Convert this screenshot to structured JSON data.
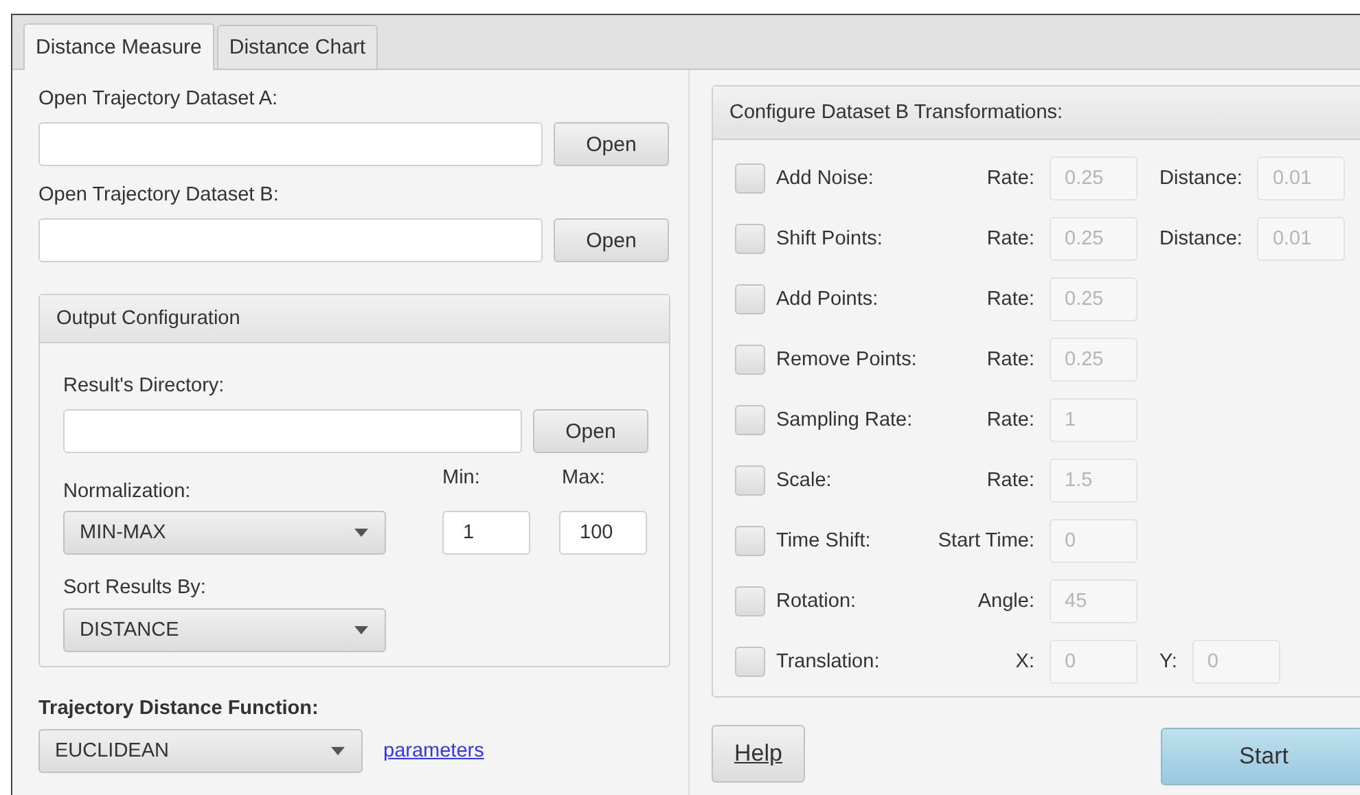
{
  "tabs": [
    {
      "label": "Distance Measure",
      "selected": true
    },
    {
      "label": "Distance Chart",
      "selected": false
    }
  ],
  "dataset_a": {
    "label": "Open Trajectory Dataset A:",
    "button": "Open"
  },
  "dataset_b": {
    "label": "Open Trajectory Dataset B:",
    "button": "Open"
  },
  "output_configuration": {
    "title": "Output Configuration",
    "results_directory": {
      "label": "Result's Directory:",
      "button": "Open"
    },
    "normalization": {
      "label": "Normalization:",
      "value": "MIN-MAX"
    },
    "min": {
      "label": "Min:",
      "value": "1"
    },
    "max": {
      "label": "Max:",
      "value": "100"
    },
    "sort_results_by": {
      "label": "Sort Results By:",
      "value": "DISTANCE"
    }
  },
  "distance_function": {
    "label": "Trajectory Distance Function:",
    "value": "EUCLIDEAN",
    "link": "parameters"
  },
  "transformations": {
    "title": "Configure Dataset B Transformations:",
    "items": [
      {
        "label": "Add Noise:",
        "checked": false,
        "params": [
          {
            "label": "Rate:",
            "value": "0.25"
          },
          {
            "label": "Distance:",
            "value": "0.01"
          }
        ]
      },
      {
        "label": "Shift Points:",
        "checked": false,
        "params": [
          {
            "label": "Rate:",
            "value": "0.25"
          },
          {
            "label": "Distance:",
            "value": "0.01"
          }
        ]
      },
      {
        "label": "Add Points:",
        "checked": false,
        "params": [
          {
            "label": "Rate:",
            "value": "0.25"
          }
        ]
      },
      {
        "label": "Remove Points:",
        "checked": false,
        "params": [
          {
            "label": "Rate:",
            "value": "0.25"
          }
        ]
      },
      {
        "label": "Sampling Rate:",
        "checked": false,
        "params": [
          {
            "label": "Rate:",
            "value": "1"
          }
        ]
      },
      {
        "label": "Scale:",
        "checked": false,
        "params": [
          {
            "label": "Rate:",
            "value": "1.5"
          }
        ]
      },
      {
        "label": "Time Shift:",
        "checked": false,
        "params": [
          {
            "label": "Start Time:",
            "value": "0"
          }
        ]
      },
      {
        "label": "Rotation:",
        "checked": false,
        "params": [
          {
            "label": "Angle:",
            "value": "45"
          }
        ]
      },
      {
        "label": "Translation:",
        "checked": false,
        "params": [
          {
            "label": "X:",
            "value": "0"
          },
          {
            "label": "Y:",
            "value": "0"
          }
        ]
      }
    ]
  },
  "buttons": {
    "help": "Help",
    "start": "Start"
  }
}
